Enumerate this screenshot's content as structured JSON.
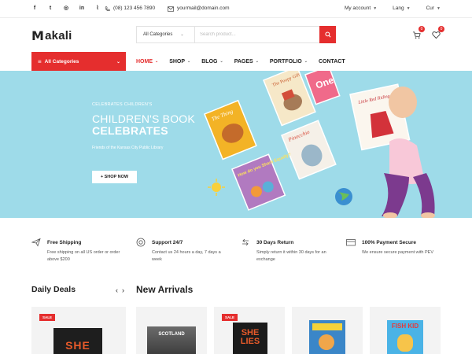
{
  "topbar": {
    "socials": [
      {
        "icon": "facebook-icon",
        "glyph": "f"
      },
      {
        "icon": "twitter-icon",
        "glyph": "t"
      },
      {
        "icon": "instagram-icon",
        "glyph": "◎"
      },
      {
        "icon": "linkedin-icon",
        "glyph": "in"
      },
      {
        "icon": "rss-icon",
        "glyph": "⌇"
      }
    ],
    "phone": "(08) 123 456 7890",
    "email": "yourmail@domain.com",
    "account": "My account",
    "language": "Lang",
    "currency": "Cur"
  },
  "header": {
    "logo_initial": "M",
    "logo_rest": "akali",
    "search_category": "All Categories",
    "search_placeholder": "Search product...",
    "cart_count": "0",
    "wishlist_count": "0"
  },
  "nav": {
    "all_categories": "All Categories",
    "items": [
      {
        "label": "HOME",
        "has_dropdown": true,
        "active": true
      },
      {
        "label": "SHOP",
        "has_dropdown": true,
        "active": false
      },
      {
        "label": "BLOG",
        "has_dropdown": true,
        "active": false
      },
      {
        "label": "PAGES",
        "has_dropdown": true,
        "active": false
      },
      {
        "label": "PORTFOLIO",
        "has_dropdown": true,
        "active": false
      },
      {
        "label": "CONTACT",
        "has_dropdown": false,
        "active": false
      }
    ]
  },
  "hero": {
    "eyebrow": "CELEBRATES CHILDREN'S",
    "title_line1": "CHILDREN'S BOOK",
    "title_line2": "CELEBRATES",
    "subtitle": "Friends of the Kansas City Public Library",
    "button": "+ SHOP NOW",
    "book_titles": [
      "The Poopy Gift",
      "Pinocchio",
      "How do you Share Equally?",
      "One",
      "Little Red Riding Hood"
    ]
  },
  "features": [
    {
      "icon": "plane-icon",
      "title": "Free Shipping",
      "desc": "Free shipping on all US order or order above $200"
    },
    {
      "icon": "support-icon",
      "title": "Support 24/7",
      "desc": "Contact us 24 hours a day, 7 days a week"
    },
    {
      "icon": "return-icon",
      "title": "30 Days Return",
      "desc": "Simply return it within 30 days for an exchange"
    },
    {
      "icon": "payment-icon",
      "title": "100% Payment Secure",
      "desc": "We ensure secure payment with PEV"
    }
  ],
  "daily_deals": {
    "title": "Daily Deals",
    "sale_label": "SALE",
    "book_text": "SHE"
  },
  "new_arrivals": {
    "title": "New Arrivals",
    "sale_label": "SALE",
    "books": [
      "SCOTLAND",
      "SHE LIES",
      "",
      "FISH KID"
    ]
  },
  "colors": {
    "accent": "#e52e2e",
    "hero_bg": "#9edbe9",
    "text": "#222222"
  }
}
